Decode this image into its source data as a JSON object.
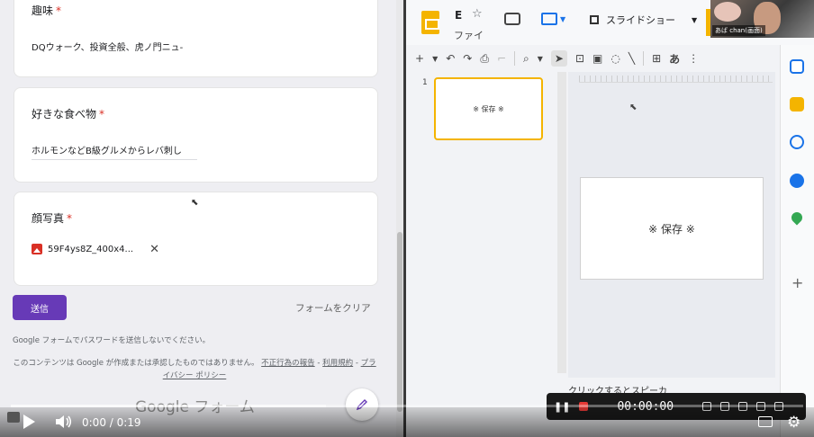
{
  "form": {
    "hobby": {
      "title": "趣味",
      "required_mark": "*",
      "answer": "DQウォーク、投資全般、虎ノ門ニュ-"
    },
    "food": {
      "title": "好きな食べ物",
      "required_mark": "*",
      "answer": "ホルモンなどB級グルメからレバ刺し"
    },
    "photo": {
      "title": "顔写真",
      "required_mark": "*",
      "file_name": "59F4ys8Z_400x4..."
    },
    "submit_label": "送信",
    "clear_label": "フォームをクリア",
    "password_note": "Google フォームでパスワードを送信しないでください。",
    "disclaimer_text": "このコンテンツは Google が作成または承認したものではありません。",
    "abuse_link": "不正行為の報告",
    "terms_link": "利用規約",
    "privacy_link": "プライバシー ポリシー",
    "brand": "Google フォーム"
  },
  "slides": {
    "doc_initial": "E",
    "menu_file": "ファイ",
    "slideshow_label": "スライドショー",
    "slide_number": "1",
    "slide_text": "※ 保存 ※",
    "speaker_notes": "クリックするとスピーカ",
    "toolbar_text_tool": "あ"
  },
  "camera": {
    "label": "あば chan(画面)"
  },
  "recorder": {
    "time": "00:00:00"
  },
  "player": {
    "current": "0:00",
    "duration": "0:19",
    "time_text": "0:00 / 0:19",
    "progress": 0
  },
  "colors": {
    "form_accent": "#673ab7",
    "slides_accent": "#f4b400",
    "required": "#d93025",
    "record": "#e53935"
  }
}
